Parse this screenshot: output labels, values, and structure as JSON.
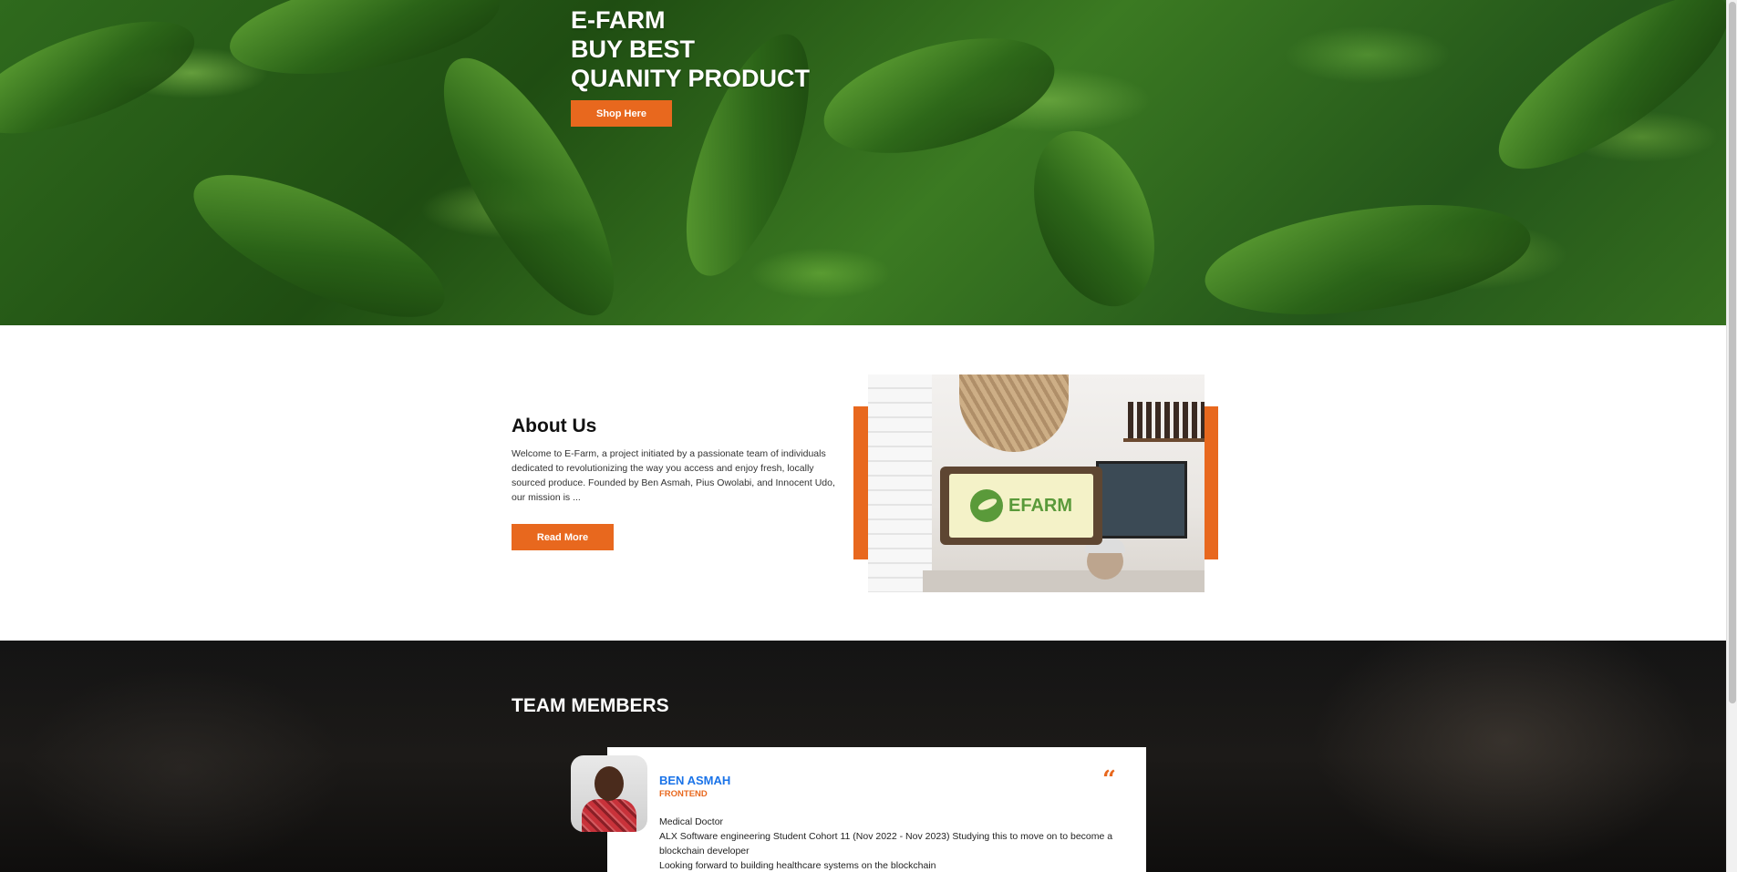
{
  "hero": {
    "line1": "E-FARM",
    "line2": "BUY BEST",
    "line3": "QUANITY PRODUCT",
    "button_label": "Shop Here"
  },
  "about": {
    "title": "About Us",
    "text": "Welcome to E-Farm, a project initiated by a passionate team of individuals dedicated to revolutionizing the way you access and enjoy fresh, locally sourced produce. Founded by Ben Asmah, Pius Owolabi, and Innocent Udo, our mission is ...",
    "button_label": "Read More",
    "sign_text": "EFARM"
  },
  "team": {
    "title": "TEAM MEMBERS",
    "members": [
      {
        "name": "BEN ASMAH",
        "role": "FRONTEND",
        "bio": [
          "Medical Doctor",
          "ALX Software engineering Student Cohort 11 (Nov 2022 - Nov 2023) Studying this to move on to become a blockchain developer",
          "Looking forward to building healthcare systems on the blockchain"
        ]
      }
    ]
  },
  "icons": {
    "quote": "quote-icon"
  },
  "colors": {
    "accent": "#e8681e",
    "name_blue": "#1a73e8",
    "team_bg": "#141414"
  }
}
